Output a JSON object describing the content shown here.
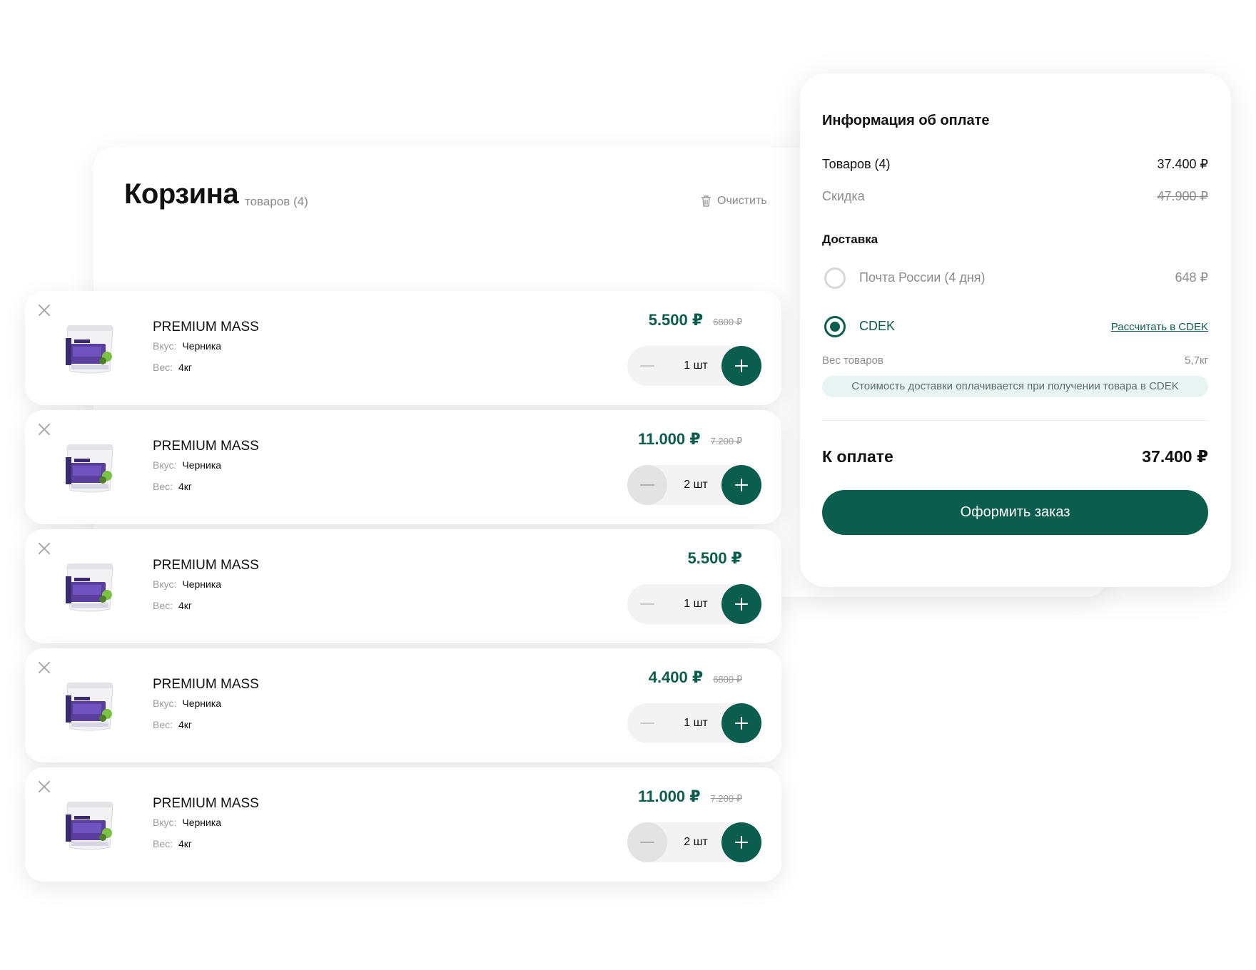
{
  "cart": {
    "title": "Корзина",
    "count_label": "товаров (4)",
    "clear_label": "Очистить"
  },
  "items": [
    {
      "name": "PREMIUM MASS",
      "flavor_label": "Вкус:",
      "flavor": "Черника",
      "weight_label": "Вес:",
      "weight": "4кг",
      "price": "5.500 ₽",
      "old_price": "6800 ₽",
      "qty": "1 шт"
    },
    {
      "name": "PREMIUM MASS",
      "flavor_label": "Вкус:",
      "flavor": "Черника",
      "weight_label": "Вес:",
      "weight": "4кг",
      "price": "11.000 ₽",
      "old_price": "7.200 ₽",
      "qty": "2 шт"
    },
    {
      "name": "PREMIUM MASS",
      "flavor_label": "Вкус:",
      "flavor": "Черника",
      "weight_label": "Вес:",
      "weight": "4кг",
      "price": "5.500 ₽",
      "old_price": "",
      "qty": "1 шт"
    },
    {
      "name": "PREMIUM MASS",
      "flavor_label": "Вкус:",
      "flavor": "Черника",
      "weight_label": "Вес:",
      "weight": "4кг",
      "price": "4.400 ₽",
      "old_price": "6800 ₽",
      "qty": "1 шт"
    },
    {
      "name": "PREMIUM MASS",
      "flavor_label": "Вкус:",
      "flavor": "Черника",
      "weight_label": "Вес:",
      "weight": "4кг",
      "price": "11.000 ₽",
      "old_price": "7.200 ₽",
      "qty": "2 шт"
    }
  ],
  "payment": {
    "title": "Информация об оплате",
    "goods_label": "Товаров (4)",
    "goods_value": "37.400 ₽",
    "discount_label": "Скидка",
    "discount_value": "47.900 ₽",
    "delivery_title": "Доставка",
    "option_post_label": "Почта России (4 дня)",
    "option_post_price": "648 ₽",
    "option_cdek_label": "CDEK",
    "calc_link": "Рассчитать в CDEK",
    "weight_label": "Вес товаров",
    "weight_value": "5,7кг",
    "note": "Стоимость доставки оплачивается при получении товара в CDEK",
    "total_label": "К оплате",
    "total_value": "37.400 ₽",
    "order_button": "Оформить заказ"
  },
  "colors": {
    "accent": "#0b5d4d",
    "note_bg": "#e8f4f2",
    "muted_text": "#8c8c8c"
  },
  "icons": [
    "trash-icon",
    "close-icon",
    "minus-icon",
    "plus-icon",
    "radio-icon"
  ]
}
